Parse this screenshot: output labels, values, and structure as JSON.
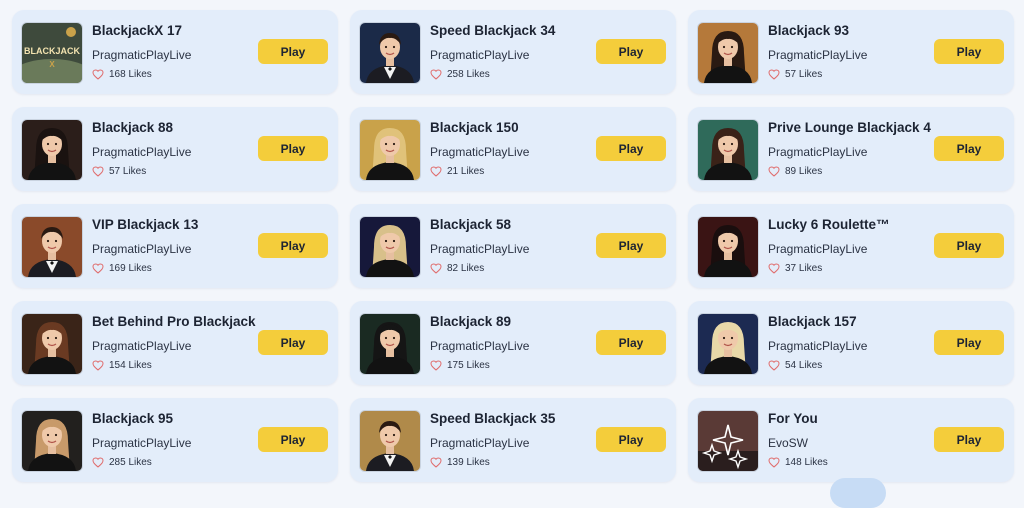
{
  "play_label": "Play",
  "colors": {
    "card_bg": "#e3edfa",
    "play_button": "#f4cd3b",
    "heart": "#e06b6b"
  },
  "games": [
    {
      "title": "BlackjackX 17",
      "provider": "PragmaticPlayLive",
      "likes": "168 Likes",
      "thumb": "blackjack-table-logo",
      "palette": [
        "#3e4a3c",
        "#caa24a"
      ]
    },
    {
      "title": "Speed Blackjack 34",
      "provider": "PragmaticPlayLive",
      "likes": "258 Likes",
      "thumb": "dealer-male",
      "palette": [
        "#1b2a48",
        "#7a5a3a"
      ]
    },
    {
      "title": "Blackjack 93",
      "provider": "PragmaticPlayLive",
      "likes": "57 Likes",
      "thumb": "dealer-female",
      "palette": [
        "#b5793a",
        "#2a1a12"
      ]
    },
    {
      "title": "Blackjack 88",
      "provider": "PragmaticPlayLive",
      "likes": "57 Likes",
      "thumb": "dealer-female",
      "palette": [
        "#2b1e1a",
        "#1a1210"
      ]
    },
    {
      "title": "Blackjack 150",
      "provider": "PragmaticPlayLive",
      "likes": "21 Likes",
      "thumb": "dealer-female",
      "palette": [
        "#c9a24a",
        "#e0c27a"
      ]
    },
    {
      "title": "Prive Lounge Blackjack 4",
      "provider": "PragmaticPlayLive",
      "likes": "89 Likes",
      "thumb": "dealer-female",
      "palette": [
        "#2f6a5a",
        "#3a2218"
      ]
    },
    {
      "title": "VIP Blackjack 13",
      "provider": "PragmaticPlayLive",
      "likes": "169 Likes",
      "thumb": "dealer-male",
      "palette": [
        "#8a4a2a",
        "#1a1a1a"
      ]
    },
    {
      "title": "Blackjack 58",
      "provider": "PragmaticPlayLive",
      "likes": "82 Likes",
      "thumb": "dealer-female",
      "palette": [
        "#16183a",
        "#d8c08a"
      ]
    },
    {
      "title": "Lucky 6 Roulette™",
      "provider": "PragmaticPlayLive",
      "likes": "37 Likes",
      "thumb": "dealer-female",
      "palette": [
        "#3a1414",
        "#1a0e0e"
      ]
    },
    {
      "title": "Bet Behind Pro Blackjack",
      "provider": "PragmaticPlayLive",
      "likes": "154 Likes",
      "thumb": "dealer-female",
      "palette": [
        "#3a2418",
        "#6a3a22"
      ]
    },
    {
      "title": "Blackjack 89",
      "provider": "PragmaticPlayLive",
      "likes": "175 Likes",
      "thumb": "dealer-female",
      "palette": [
        "#1a2a22",
        "#151515"
      ]
    },
    {
      "title": "Blackjack 157",
      "provider": "PragmaticPlayLive",
      "likes": "54 Likes",
      "thumb": "dealer-female",
      "palette": [
        "#1c2a52",
        "#e8d8a8"
      ]
    },
    {
      "title": "Blackjack 95",
      "provider": "PragmaticPlayLive",
      "likes": "285 Likes",
      "thumb": "dealer-female",
      "palette": [
        "#22201e",
        "#c89a6a"
      ]
    },
    {
      "title": "Speed Blackjack 35",
      "provider": "PragmaticPlayLive",
      "likes": "139 Likes",
      "thumb": "dealer-male",
      "palette": [
        "#b08a4a",
        "#2a1a10"
      ]
    },
    {
      "title": "For You",
      "provider": "EvoSW",
      "likes": "148 Likes",
      "thumb": "sparkle-stars",
      "palette": [
        "#5a3a36",
        "#2a1e1e"
      ]
    }
  ]
}
